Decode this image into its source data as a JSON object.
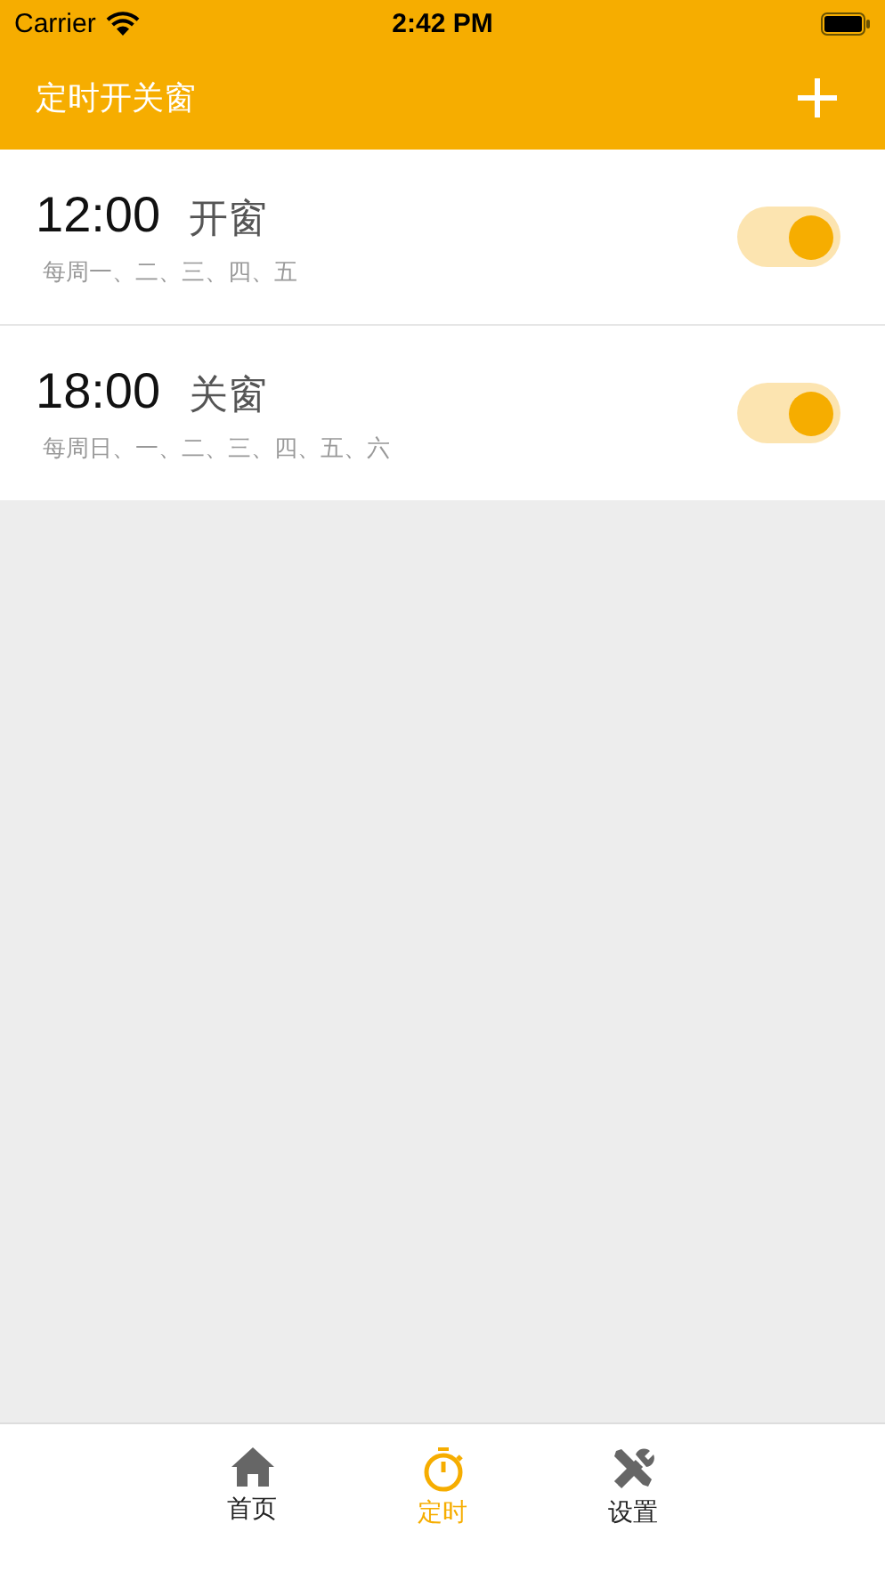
{
  "status_bar": {
    "carrier": "Carrier",
    "time": "2:42 PM"
  },
  "nav_bar": {
    "title": "定时开关窗"
  },
  "timers": [
    {
      "time": "12:00",
      "action": "开窗",
      "repeat": "每周一、二、三、四、五",
      "on": true
    },
    {
      "time": "18:00",
      "action": "关窗",
      "repeat": "每周日、一、二、三、四、五、六",
      "on": true
    }
  ],
  "tab_bar": [
    {
      "kind": "home",
      "label": "首页",
      "selected": false
    },
    {
      "kind": "timer",
      "label": "定时",
      "selected": true
    },
    {
      "kind": "settings",
      "label": "设置",
      "selected": false
    }
  ]
}
